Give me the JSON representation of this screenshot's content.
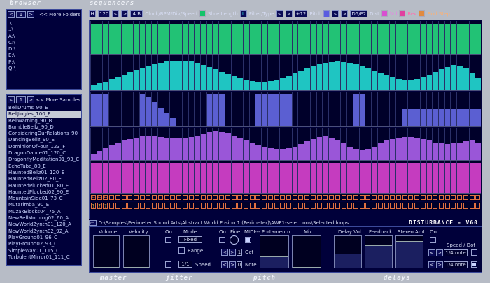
{
  "sections": {
    "browser": "browser",
    "sequencers": "sequencers",
    "master": "master",
    "jitter": "jitter",
    "pitch": "pitch",
    "delays": "delays"
  },
  "browser": {
    "folders_nav": {
      "left": "<",
      "page": "1",
      "right": ">",
      "more": "<< More Folders"
    },
    "folders": [
      ".\\",
      "..\\",
      "A:\\",
      "C:\\",
      "D:\\",
      "E:\\",
      "P:\\",
      "Q:\\"
    ],
    "samples_nav": {
      "left": "<",
      "page": "1",
      "right": ">",
      "more": "<< More Samples"
    },
    "samples": [
      "BellDrums_90_E",
      "BellJingles_100_E",
      "BellWarning_90_B",
      "BumbleBellz_90_D",
      "ConsideringOurRelations_90_",
      "DancingBellz_90_E",
      "DominionOfFour_123_F",
      "DragonDance01_120_C",
      "DragonflyMeditation01_93_C",
      "EchoTube_80_E",
      "HauntedBellz01_120_E",
      "HauntedBellz02_80_E",
      "HauntedPlucked01_80_E",
      "HauntedPlucked02_90_E",
      "MountainSide01_73_C",
      "Mutarimba_90_E",
      "MuzakBlocks04_75_A",
      "NewBellMorning02_60_A",
      "NewWorldZynth01_120_A",
      "NewWorldZynth02_92_A",
      "PlayGround01_96_C",
      "PlayGround02_93_C",
      "SimpleWay01_115_C",
      "TurbulentMirror01_111_C"
    ],
    "selected_index": 1
  },
  "toolbar": {
    "h_label": "H",
    "bpm": "120",
    "prev": "<",
    "next": ">",
    "bars": "4 B",
    "clock_label": "Clock/BPM/Div/Speed",
    "slice_length": "Slice Length",
    "l_label": "L",
    "filter_type": "Filter/Type",
    "pitch_value": "+12",
    "pitch_label": "Pitch",
    "note_value": "D5/F2",
    "dist_label": "Dist",
    "vol_label": "Vol",
    "rev_label": "Rev",
    "find_step": "Find Step",
    "colors": {
      "slice": "#15c46a",
      "filter": "#2bd7d2",
      "pitch": "#5a5ce0",
      "dist": "#a24ee0",
      "vol": "#d84fd0",
      "rev": "#e040a0",
      "find": "#e08a40"
    }
  },
  "lanes": [
    {
      "name": "slice-length",
      "color": "#22c275",
      "values": [
        0.92,
        0.92,
        0.92,
        0.92,
        0.92,
        0.92,
        0.92,
        0.92,
        0.92,
        0.92,
        0.92,
        0.92,
        0.92,
        0.92,
        0.92,
        0.92,
        0.92,
        0.92,
        0.92,
        0.92,
        0.92,
        0.92,
        0.92,
        0.92,
        0.92,
        0.92,
        0.92,
        0.92,
        0.92,
        0.92,
        0.92,
        0.92,
        0.92,
        0.92,
        0.92,
        0.92,
        0.92,
        0.92,
        0.92,
        0.92,
        0.92,
        0.92,
        0.92,
        0.92,
        0.92,
        0.92,
        0.92,
        0.92,
        0.92,
        0.92,
        0.92,
        0.92,
        0.92,
        0.92,
        0.92,
        0.92,
        0.92,
        0.92,
        0.92,
        0.92,
        0.92,
        0.92,
        0.92,
        0.92
      ]
    },
    {
      "name": "filter",
      "color": "#1fc5c2",
      "values": [
        0.15,
        0.2,
        0.25,
        0.32,
        0.38,
        0.45,
        0.52,
        0.58,
        0.64,
        0.7,
        0.75,
        0.79,
        0.82,
        0.84,
        0.85,
        0.84,
        0.82,
        0.78,
        0.72,
        0.66,
        0.6,
        0.53,
        0.46,
        0.4,
        0.35,
        0.3,
        0.27,
        0.25,
        0.25,
        0.27,
        0.3,
        0.35,
        0.41,
        0.48,
        0.55,
        0.62,
        0.68,
        0.74,
        0.78,
        0.8,
        0.82,
        0.81,
        0.78,
        0.74,
        0.69,
        0.63,
        0.56,
        0.5,
        0.44,
        0.38,
        0.33,
        0.3,
        0.3,
        0.33,
        0.38,
        0.45,
        0.52,
        0.6,
        0.67,
        0.72,
        0.7,
        0.62,
        0.5,
        0.35
      ]
    },
    {
      "name": "pitch",
      "color": "#5b5fd2",
      "values": [
        0.95,
        0.95,
        0.95,
        0.0,
        0.0,
        0.0,
        0.0,
        0.0,
        0.95,
        0.85,
        0.7,
        0.55,
        0.4,
        0.25,
        0.0,
        0.0,
        0.0,
        0.0,
        0.0,
        0.95,
        0.95,
        0.95,
        0.0,
        0.0,
        0.0,
        0.0,
        0.0,
        0.95,
        0.95,
        0.95,
        0.95,
        0.95,
        0.95,
        0.0,
        0.0,
        0.0,
        0.0,
        0.0,
        0.0,
        0.0,
        0.0,
        0.0,
        0.0,
        0.95,
        0.95,
        0.0,
        0.0,
        0.0,
        0.0,
        0.0,
        0.0,
        0.5,
        0.5,
        0.5,
        0.5,
        0.5,
        0.5,
        0.5,
        0.5,
        0.5,
        0.5,
        0.5,
        0.5,
        0.5
      ]
    },
    {
      "name": "dist",
      "color": "#9a56d8",
      "values": [
        0.2,
        0.28,
        0.36,
        0.45,
        0.52,
        0.6,
        0.65,
        0.7,
        0.73,
        0.75,
        0.74,
        0.72,
        0.7,
        0.68,
        0.68,
        0.7,
        0.72,
        0.75,
        0.8,
        0.86,
        0.9,
        0.88,
        0.83,
        0.77,
        0.7,
        0.62,
        0.55,
        0.48,
        0.42,
        0.37,
        0.35,
        0.35,
        0.37,
        0.42,
        0.5,
        0.58,
        0.66,
        0.72,
        0.74,
        0.7,
        0.62,
        0.52,
        0.42,
        0.35,
        0.32,
        0.35,
        0.42,
        0.52,
        0.6,
        0.66,
        0.7,
        0.72,
        0.72,
        0.7,
        0.66,
        0.6,
        0.55,
        0.52,
        0.5,
        0.52,
        0.55,
        0.58,
        0.62,
        0.55
      ]
    },
    {
      "name": "vol",
      "color": "#c53cbf",
      "values": [
        0.95,
        0.95,
        0.95,
        0.95,
        0.95,
        0.95,
        0.95,
        0.95,
        0.95,
        0.95,
        0.95,
        0.95,
        0.95,
        0.95,
        0.95,
        0.95,
        0.95,
        0.95,
        0.95,
        0.95,
        0.95,
        0.95,
        0.95,
        0.95,
        0.95,
        0.95,
        0.95,
        0.95,
        0.95,
        0.95,
        0.95,
        0.95,
        0.95,
        0.95,
        0.95,
        0.95,
        0.95,
        0.95,
        0.95,
        0.95,
        0.95,
        0.95,
        0.95,
        0.95,
        0.95,
        0.95,
        0.95,
        0.95,
        0.95,
        0.95,
        0.95,
        0.95,
        0.95,
        0.95,
        0.95,
        0.95,
        0.95,
        0.95,
        0.95,
        0.95,
        0.95,
        0.95,
        0.95,
        0.95
      ]
    }
  ],
  "status": {
    "path": "D:\\Samples\\Perimeter Sound Arts\\Abstract World Fusion 1 (Perimeter)\\AWF1-selections\\Selected loops",
    "brand": "DISTURBANCE - V60"
  },
  "master": {
    "volume_label": "Volume",
    "velocity_label": "Velocity"
  },
  "jitter": {
    "on_label": "On",
    "mode_label": "Mode",
    "mode_value": "Fixed",
    "range_label": "Range",
    "speed_value": "1/1",
    "speed_label": "Speed"
  },
  "pitch": {
    "on_label": "On",
    "fine_label": "Fine",
    "midi_label": "MIDI",
    "portamento_label": "--- Portamento",
    "mix_label": "Mix",
    "oct_value": "1",
    "oct_label": "Oct",
    "note_value": "0",
    "note_label": "Note"
  },
  "delays": {
    "delay_vol_label": "Delay Vol",
    "feedback_label": "Feedback",
    "stereo_amt_label": "Stereo Amt",
    "on_label": "On",
    "speed_dot_label": "Speed / Dot",
    "speed1": "1/4 note",
    "speed2": "1/4 note"
  }
}
